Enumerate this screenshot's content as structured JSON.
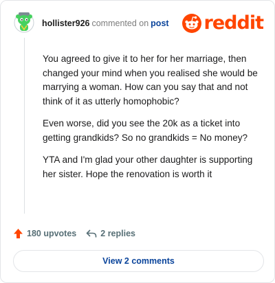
{
  "header": {
    "username": "hollister926",
    "verb": "commented on",
    "target": "post",
    "brand": "reddit"
  },
  "comment": {
    "paragraphs": [
      "You agreed to give it to her for her marriage, then changed your mind when you realised she would be marrying a woman. How can you say that and not think of it as utterly homophobic?",
      "Even worse, did you see the 20k as a ticket into getting grandkids? So no grandkids = No money?",
      "YTA and I'm glad your other daughter is supporting her sister. Hope the renovation is worth it"
    ]
  },
  "actions": {
    "upvotes_label": "180 upvotes",
    "replies_label": "2 replies",
    "upvote_icon": "arrow-up-icon",
    "reply_icon": "reply-arrow-icon"
  },
  "footer": {
    "view_comments_label": "View 2 comments"
  },
  "colors": {
    "brand": "#ff4500",
    "link": "#0a449b",
    "muted": "#576f76",
    "avatar_green": "#46d160"
  }
}
